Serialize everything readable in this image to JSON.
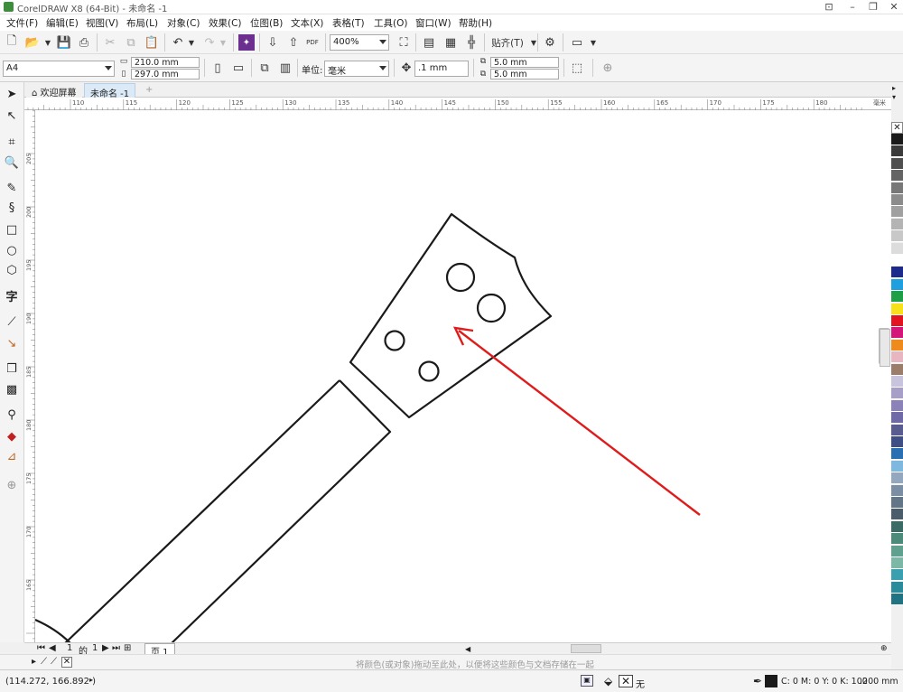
{
  "window": {
    "title": "CorelDRAW X8 (64-Bit) - 未命名 -1"
  },
  "menu": [
    "文件(F)",
    "编辑(E)",
    "视图(V)",
    "布局(L)",
    "对象(C)",
    "效果(C)",
    "位图(B)",
    "文本(X)",
    "表格(T)",
    "工具(O)",
    "窗口(W)",
    "帮助(H)"
  ],
  "toolbar": {
    "zoom": "400%",
    "snap_label": "贴齐(T)",
    "pdf_label": "PDF"
  },
  "property_bar": {
    "page_size": "A4",
    "width": "210.0 mm",
    "height": "297.0 mm",
    "units_label": "单位:",
    "units_value": "毫米",
    "nudge": ".1 mm",
    "dup_x": "5.0 mm",
    "dup_y": "5.0 mm"
  },
  "tabs": {
    "welcome": "欢迎屏幕",
    "doc": "未命名 -1"
  },
  "ruler": {
    "h_ticks": [
      "110",
      "115",
      "120",
      "125",
      "130",
      "135",
      "140",
      "145",
      "150",
      "155",
      "160",
      "165",
      "170",
      "175",
      "180"
    ],
    "h_unit": "毫米",
    "v_ticks": [
      "205",
      "200",
      "195",
      "190",
      "185",
      "180",
      "175",
      "170",
      "165"
    ]
  },
  "doc_nav": {
    "page_current": "1",
    "page_of": "的",
    "page_total": "1",
    "page_tab": "页 1"
  },
  "hint_bar": {
    "text": "将颜色(或对象)拖动至此处，以便将这些颜色与文档存储在一起"
  },
  "status": {
    "coords": "(114.272, 166.892 )",
    "fill_none": "无",
    "outline_color": "C: 0 M: 0 Y: 0 K: 100",
    "outline_width": ".200 mm"
  },
  "colors": {
    "annotation_arrow": "#e01b1b",
    "shape_stroke": "#1a1a1a",
    "palette": [
      "#1a1a1a",
      "#3b3b3b",
      "#4f4f4f",
      "#646464",
      "#787878",
      "#8c8c8c",
      "#a0a0a0",
      "#b4b4b4",
      "#c8c8c8",
      "#dcdcdc",
      "#ffffff",
      "#1c2a8c",
      "#1e9fe0",
      "#1f9e48",
      "#f6e11a",
      "#e3141f",
      "#d4157a",
      "#ef8a1d",
      "#e8b6c1",
      "#9b7d6a",
      "#c9c4de",
      "#a89fc9",
      "#8a82b8",
      "#6f6aa5",
      "#5a5b8f",
      "#3f4f86",
      "#2b6fb3",
      "#7fb8de",
      "#93a7bf",
      "#7a8fa3",
      "#627688",
      "#4b5c6b",
      "#3a6b64",
      "#4c8a7a",
      "#5fa08e",
      "#7bb8a5",
      "#3aa0b0",
      "#2c8b9a",
      "#1f7383"
    ]
  }
}
